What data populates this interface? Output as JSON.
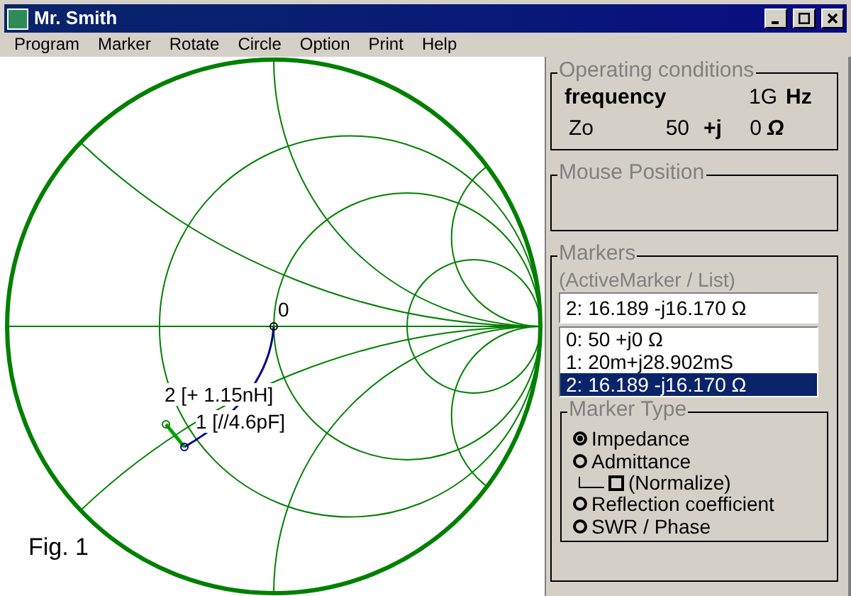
{
  "window": {
    "title": "Mr. Smith"
  },
  "menu": [
    "Program",
    "Marker",
    "Rotate",
    "Circle",
    "Option",
    "Print",
    "Help"
  ],
  "smith_chart": {
    "labels": [
      {
        "text": "0"
      },
      {
        "text": "2 [+ 1.15nH]"
      },
      {
        "text": "1 [//4.6pF]"
      }
    ],
    "figure_label": "Fig. 1"
  },
  "operating_conditions": {
    "title": "Operating conditions",
    "frequency_label": "frequency",
    "frequency_value": "1G",
    "frequency_unit": "Hz",
    "zo_label": "Zo",
    "zo_real": "50",
    "zo_j": "+j",
    "zo_imag": "0",
    "zo_unit": "Ω"
  },
  "mouse_position": {
    "title": "Mouse Position"
  },
  "markers": {
    "title": "Markers",
    "hint": "(ActiveMarker / List)",
    "active_marker": "2: 16.189 -j16.170 Ω",
    "list": [
      {
        "text": "0: 50 +j0 Ω",
        "selected": false
      },
      {
        "text": "1: 20m+j28.902mS",
        "selected": false
      },
      {
        "text": "2: 16.189 -j16.170 Ω",
        "selected": true
      }
    ]
  },
  "marker_type": {
    "title": "Marker Type",
    "options": [
      {
        "label": "Impedance",
        "selected": true
      },
      {
        "label": "Admittance",
        "selected": false
      }
    ],
    "normalize": {
      "label": "(Normalize)",
      "checked": false
    },
    "options_2": [
      {
        "label": "Reflection coefficient",
        "selected": false
      },
      {
        "label": "SWR / Phase",
        "selected": false
      }
    ]
  }
}
